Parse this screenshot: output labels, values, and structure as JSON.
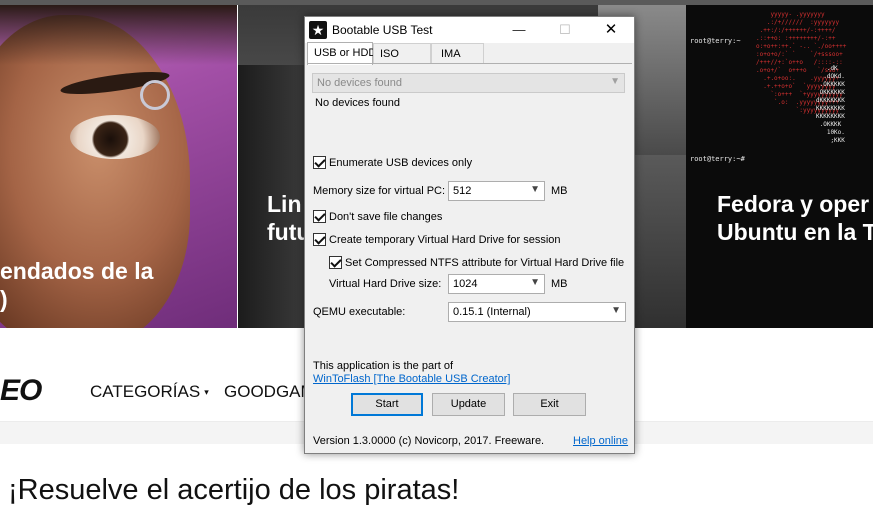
{
  "background": {
    "cards": [
      {
        "caption_lines": [
          "endados de la",
          ")"
        ]
      },
      {
        "caption_lines": [
          "Lin",
          "futu"
        ]
      },
      {
        "caption_lines": [
          "Fedora y oper",
          "Ubuntu en la T"
        ]
      }
    ],
    "terminal_prompt_1": "root@terry:~",
    "terminal_prompt_2": "root@terry:~#",
    "nav": {
      "logo": "EO",
      "categories": "CATEGORÍAS",
      "categories_caret": "▾",
      "goodgame": "GOODGAM"
    },
    "headline": "¡Resuelve el acertijo de los piratas!"
  },
  "dialog": {
    "title": "Bootable USB Test",
    "icon": "star-icon",
    "window_buttons": {
      "minimize": "—",
      "maximize": "☐",
      "close": "✕"
    },
    "tabs": [
      {
        "label": "USB or HDD",
        "active": true
      },
      {
        "label": "ISO",
        "active": false
      },
      {
        "label": "IMA",
        "active": false
      }
    ],
    "device_combo": {
      "value": "No devices found",
      "disabled": true
    },
    "device_status": "No devices found",
    "enumerate_usb_only": {
      "label": "Enumerate USB devices only",
      "checked": true
    },
    "memory": {
      "label": "Memory size for virtual PC:",
      "value": "512",
      "unit": "MB"
    },
    "dont_save": {
      "label": "Don't save file changes",
      "checked": true
    },
    "create_vhd": {
      "label": "Create temporary Virtual Hard Drive for session",
      "checked": true
    },
    "compressed_ntfs": {
      "label": "Set Compressed NTFS attribute for Virtual Hard Drive file",
      "checked": true
    },
    "vhd_size": {
      "label": "Virtual Hard Drive size:",
      "value": "1024",
      "unit": "MB"
    },
    "qemu": {
      "label": "QEMU executable:",
      "value": "0.15.1 (Internal)"
    },
    "info_text": "This application is the part of",
    "wintoflash_link": "WinToFlash [The Bootable USB Creator]",
    "buttons": {
      "start": "Start",
      "update": "Update",
      "exit": "Exit"
    },
    "version": "Version 1.3.0000  (c) Novicorp, 2017. Freeware.",
    "help_link": "Help online",
    "colors": {
      "accent": "#0078d7",
      "link": "#0066cc"
    }
  }
}
